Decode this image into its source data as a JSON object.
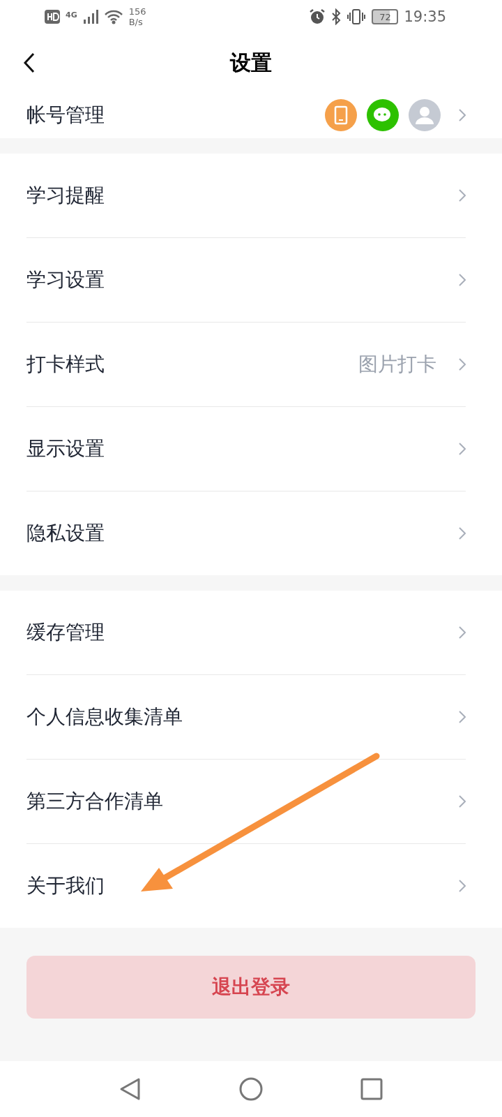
{
  "status_bar": {
    "network": "4G",
    "speed_value": "156",
    "speed_unit": "B/s",
    "battery": "72",
    "time": "19:35"
  },
  "header": {
    "title": "设置"
  },
  "account": {
    "label": "帐号管理",
    "linked": [
      {
        "kind": "phone",
        "color": "#f5a04a"
      },
      {
        "kind": "chat",
        "color": "#2dc100"
      },
      {
        "kind": "person",
        "color": "#c5cad3"
      }
    ]
  },
  "groups": [
    {
      "items": [
        {
          "label": "学习提醒"
        },
        {
          "label": "学习设置"
        },
        {
          "label": "打卡样式",
          "value": "图片打卡"
        },
        {
          "label": "显示设置"
        },
        {
          "label": "隐私设置"
        }
      ]
    },
    {
      "items": [
        {
          "label": "缓存管理"
        },
        {
          "label": "个人信息收集清单"
        },
        {
          "label": "第三方合作清单"
        },
        {
          "label": "关于我们"
        }
      ]
    }
  ],
  "logout_button": "退出登录",
  "annotation": {
    "kind": "arrow",
    "color": "#f7913d"
  }
}
